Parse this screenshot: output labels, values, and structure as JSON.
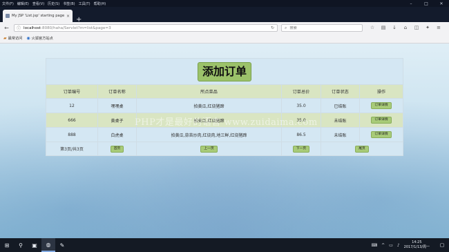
{
  "menubar": [
    "文件(F)",
    "编辑(E)",
    "查看(V)",
    "历史(S)",
    "书签(B)",
    "工具(T)",
    "帮助(H)"
  ],
  "tab": {
    "title": "My JSP 'List.jsp' starting page",
    "close": "×"
  },
  "new_tab": "+",
  "url": {
    "host": "localhost",
    "path": ":8080/haha/Servlet?m=list&page=3"
  },
  "search": {
    "placeholder": "搜索"
  },
  "bookmarks": [
    {
      "label": "最常访问"
    },
    {
      "label": "火狐官方站点"
    }
  ],
  "page": {
    "title": "添加订单",
    "headers": [
      "订单编号",
      "订单名称",
      "所点菜品",
      "订单总价",
      "订单状态",
      "操作"
    ],
    "rows": [
      {
        "id": "12",
        "name": "嘿嘿桌",
        "dishes": "拍黄瓜,红烧猪蹄",
        "total": "35.0",
        "status": "已结账",
        "action": "订单详情"
      },
      {
        "id": "666",
        "name": "黄桌子",
        "dishes": "拍黄瓜,红烧猪蹄",
        "total": "35.0",
        "status": "未结账",
        "action": "订单详情"
      },
      {
        "id": "888",
        "name": "白虎桌",
        "dishes": "拍黄瓜,蒜苔炒肉,红烧肉,地三鲜,红烧猪蹄",
        "total": "86.5",
        "status": "未结账",
        "action": "订单详情"
      }
    ],
    "pager": {
      "info": "第3页/共3页",
      "first": "首页",
      "prev": "上一页",
      "next": "下一页",
      "last": "尾页"
    },
    "watermark": "PHP才是最好的语言 www.zuidaima.com"
  },
  "taskbar": {
    "time": "14:25",
    "date": "2017/1/13/周一"
  }
}
